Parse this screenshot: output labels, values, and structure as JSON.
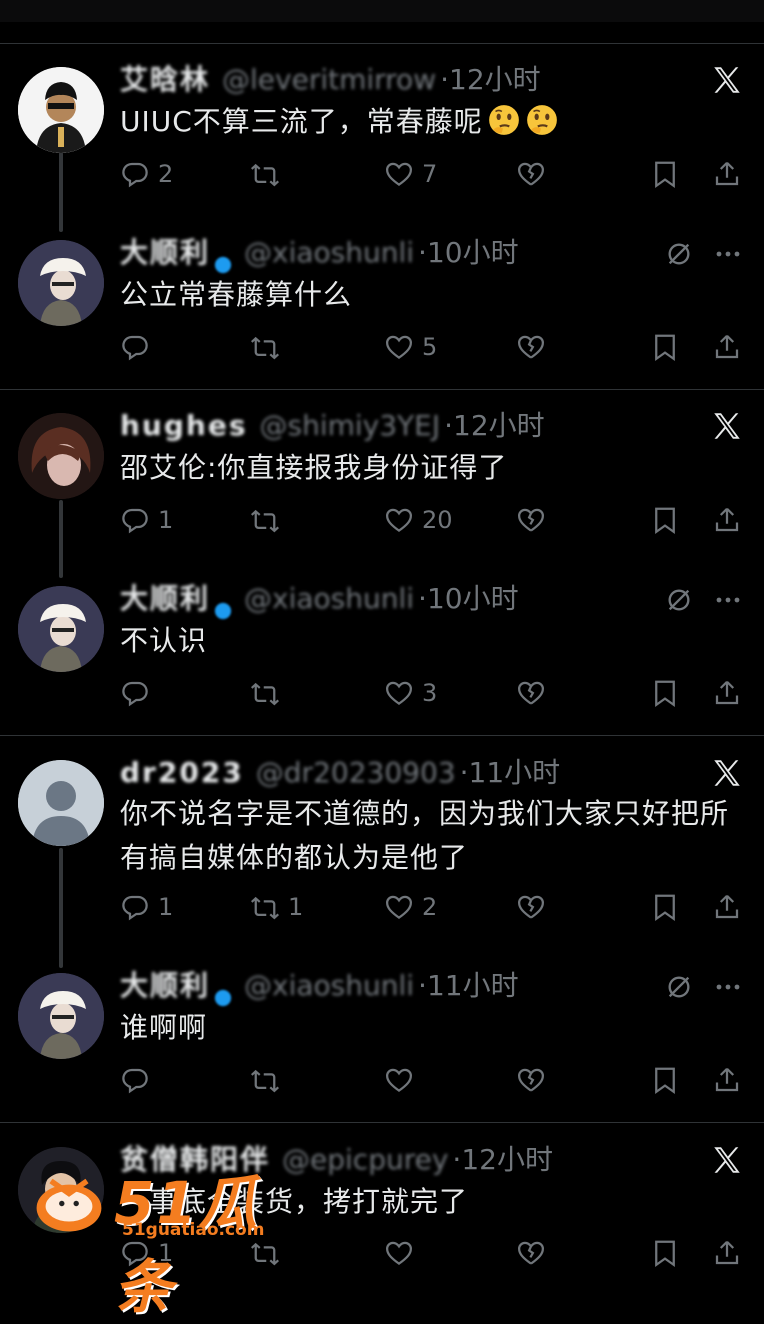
{
  "posts": [
    {
      "name": "艾晗林",
      "handle": "@leveritmirrow",
      "time": "12小时",
      "text": "UIUC不算三流了，常春藤呢",
      "emoji": [
        "thinking-face",
        "thinking-face"
      ],
      "icon_right": "x-logo-icon",
      "replies": "2",
      "retweets": "",
      "likes": "7"
    },
    {
      "name": "大顺利",
      "handle": "@xiaoshunli",
      "time": "10小时",
      "text": "公立常春藤算什么",
      "icon_right": "grok-icon",
      "replies": "",
      "retweets": "",
      "likes": "5"
    },
    {
      "name": "hughes",
      "handle": "@shimiy3YEJ",
      "time": "12小时",
      "text": "邵艾伦:你直接报我身份证得了",
      "icon_right": "x-logo-icon",
      "replies": "1",
      "retweets": "",
      "likes": "20"
    },
    {
      "name": "大顺利",
      "handle": "@xiaoshunli",
      "time": "10小时",
      "text": "不认识",
      "icon_right": "grok-icon",
      "replies": "",
      "retweets": "",
      "likes": "3"
    },
    {
      "name": "dr2023",
      "handle": "@dr20230903",
      "time": "11小时",
      "text": "你不说名字是不道德的，因为我们大家只好把所有搞自媒体的都认为是他了",
      "icon_right": "x-logo-icon",
      "replies": "1",
      "retweets": "1",
      "likes": "2"
    },
    {
      "name": "大顺利",
      "handle": "@xiaoshunli",
      "time": "11小时",
      "text": "谁啊啊",
      "icon_right": "grok-icon",
      "replies": "",
      "retweets": "",
      "likes": ""
    },
    {
      "name": "贫僧韩阳伴",
      "handle": "@epicpurey",
      "time": "12小时",
      "text": "一事底全装货，拷打就完了",
      "icon_right": "x-logo-icon",
      "replies": "1",
      "retweets": "",
      "likes": ""
    }
  ],
  "watermark": {
    "brand": "51瓜条",
    "url": "51guatiao.com"
  },
  "colors": {
    "background": "#000000",
    "text": "#e7e9ea",
    "muted": "#71767b",
    "divider": "#2f3336"
  }
}
